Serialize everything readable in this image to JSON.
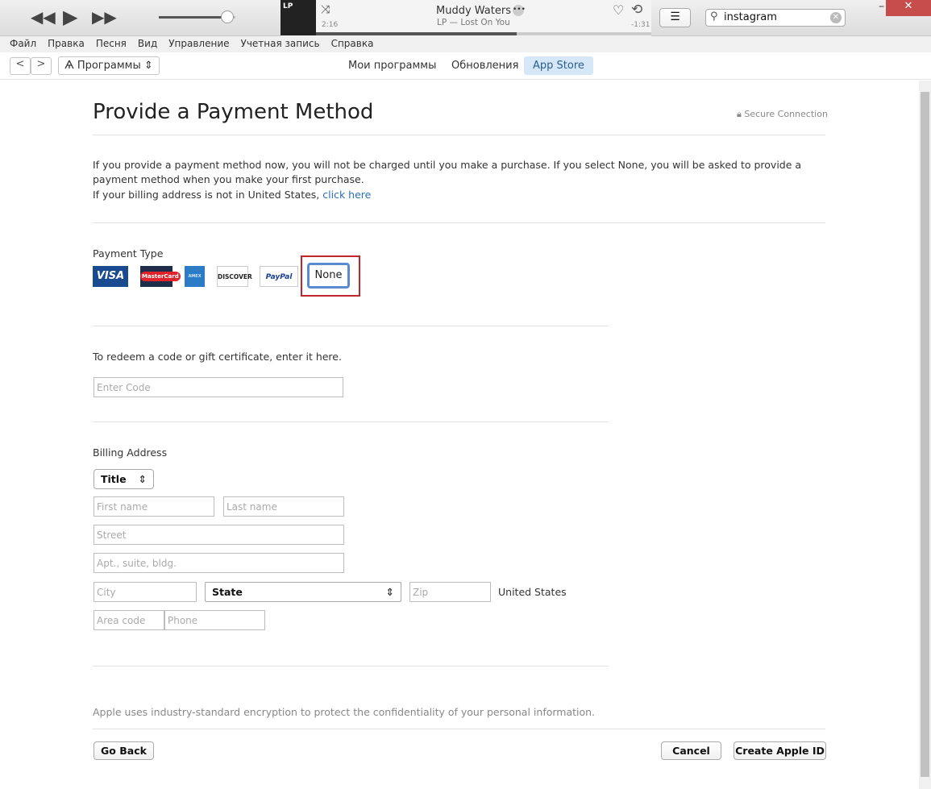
{
  "player": {
    "track_title": "Muddy Waters",
    "track_artist": "LP — Lost On You",
    "elapsed": "2:16",
    "remaining": "-1:31",
    "album_art_text": "LP",
    "volume": 0.85,
    "progress": 0.6
  },
  "search": {
    "value": "instagram"
  },
  "menu": [
    "Файл",
    "Правка",
    "Песня",
    "Вид",
    "Управление",
    "Учетная запись",
    "Справка"
  ],
  "nav": {
    "section": "Программы",
    "tabs": [
      "Мои программы",
      "Обновления",
      "App Store"
    ],
    "active_tab": "App Store"
  },
  "page": {
    "title": "Provide a Payment Method",
    "secure": "Secure Connection",
    "intro": "If you provide a payment method now, you will not be charged until you make a purchase. If you select None, you will be asked to provide a payment method when you make your first purchase.",
    "billing_note": "If your billing address is not in United States,",
    "billing_link": "click here",
    "payment_type_label": "Payment Type",
    "cards": [
      "VISA",
      "MasterCard",
      "AMEX",
      "DISCOVER",
      "PayPal",
      "None"
    ],
    "selected_payment": "None",
    "redeem_label": "To redeem a code or gift certificate, enter it here.",
    "code_placeholder": "Enter Code",
    "billing_label": "Billing Address",
    "title_select": "Title",
    "first_name": "First name",
    "last_name": "Last name",
    "street": "Street",
    "apt": "Apt., suite, bldg.",
    "city": "City",
    "state_select": "State",
    "zip": "Zip",
    "country": "United States",
    "area_code": "Area code",
    "phone": "Phone",
    "encryption_note": "Apple uses industry-standard encryption to protect the confidentiality of your personal information.",
    "go_back": "Go Back",
    "cancel": "Cancel",
    "create": "Create Apple ID"
  },
  "colors": {
    "highlight_border": "#c0272d",
    "link": "#2a6ebb",
    "active_tab_bg": "#d6e8f7"
  }
}
